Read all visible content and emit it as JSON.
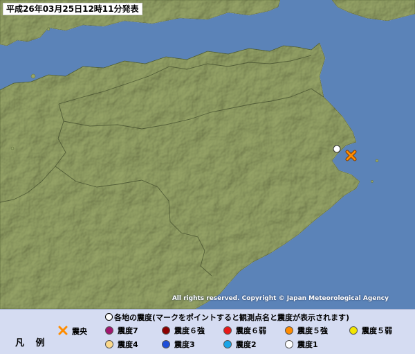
{
  "header": {
    "title": "平成26年03月25日12時11分発表"
  },
  "map": {
    "sea_color": "#5b83b8",
    "land_color": "#97a568",
    "copyright": "All rights reserved. Copyright © Japan Meteorological Agency",
    "epicenter_icon": "epicenter-cross-icon",
    "station_icon": "intensity-1-station-icon",
    "station_intensity": "震度1"
  },
  "legend": {
    "title": "凡 例",
    "header": "各地の震度(マークをポイントすると観測点名と震度が表示されます)",
    "items": [
      {
        "label": "震央",
        "color": "#ff8c00",
        "icon": "epicenter-cross-icon"
      },
      {
        "label": "震度7",
        "color": "#a0166e",
        "icon": "intensity-7-dot-icon"
      },
      {
        "label": "震度６強",
        "color": "#8b0000",
        "icon": "intensity-6-strong-dot-icon"
      },
      {
        "label": "震度６弱",
        "color": "#e81818",
        "icon": "intensity-6-weak-dot-icon"
      },
      {
        "label": "震度５強",
        "color": "#ff8c00",
        "icon": "intensity-5-strong-dot-icon"
      },
      {
        "label": "震度５弱",
        "color": "#f2e600",
        "icon": "intensity-5-weak-dot-icon"
      },
      {
        "label": "震度4",
        "color": "#fcd98a",
        "icon": "intensity-4-dot-icon"
      },
      {
        "label": "震度3",
        "color": "#1e4ed8",
        "icon": "intensity-3-dot-icon"
      },
      {
        "label": "震度2",
        "color": "#1aa5e8",
        "icon": "intensity-2-dot-icon"
      },
      {
        "label": "震度1",
        "color": "#ffffff",
        "icon": "intensity-1-dot-icon"
      }
    ]
  }
}
